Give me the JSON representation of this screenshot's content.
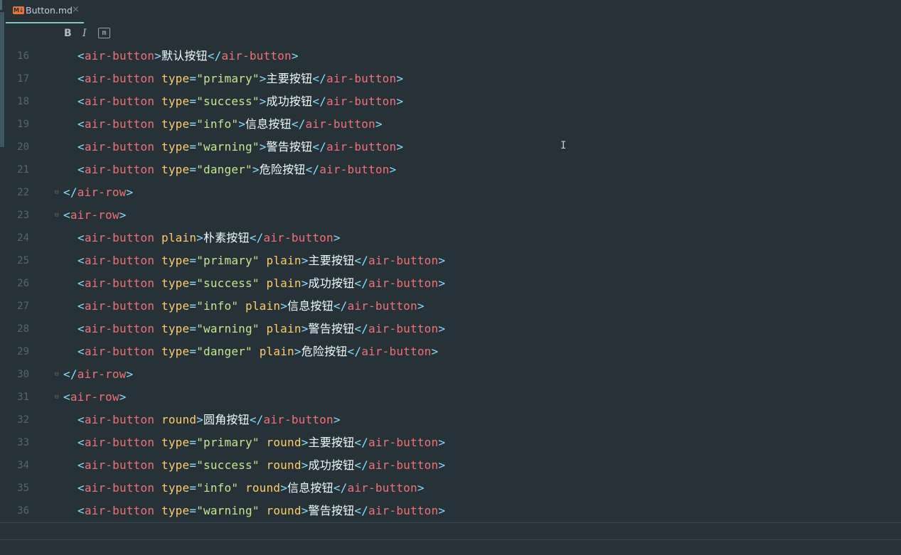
{
  "tab": {
    "icon": "markdown-icon",
    "icon_text": "M↓",
    "label": "Button.md",
    "close": "×"
  },
  "toolbar": {
    "bold": "B",
    "italic": "I",
    "mono": "m"
  },
  "colors": {
    "bg": "#263238",
    "punct": "#89ddff",
    "tag": "#f07178",
    "attr": "#ffcb6b",
    "string": "#c3e88d",
    "text": "#eeffff"
  },
  "lines": [
    {
      "num": "16",
      "indent": true,
      "fold": false,
      "tokens": [
        [
          "p",
          "<"
        ],
        [
          "t",
          "air-button"
        ],
        [
          "p",
          ">"
        ],
        [
          "x",
          "默认按钮"
        ],
        [
          "p",
          "</"
        ],
        [
          "t",
          "air-button"
        ],
        [
          "p",
          ">"
        ]
      ]
    },
    {
      "num": "17",
      "indent": true,
      "fold": false,
      "tokens": [
        [
          "p",
          "<"
        ],
        [
          "t",
          "air-button"
        ],
        [
          "a",
          " type"
        ],
        [
          "p",
          "="
        ],
        [
          "s",
          "\"primary\""
        ],
        [
          "p",
          ">"
        ],
        [
          "x",
          "主要按钮"
        ],
        [
          "p",
          "</"
        ],
        [
          "t",
          "air-button"
        ],
        [
          "p",
          ">"
        ]
      ]
    },
    {
      "num": "18",
      "indent": true,
      "fold": false,
      "tokens": [
        [
          "p",
          "<"
        ],
        [
          "t",
          "air-button"
        ],
        [
          "a",
          " type"
        ],
        [
          "p",
          "="
        ],
        [
          "s",
          "\"success\""
        ],
        [
          "p",
          ">"
        ],
        [
          "x",
          "成功按钮"
        ],
        [
          "p",
          "</"
        ],
        [
          "t",
          "air-button"
        ],
        [
          "p",
          ">"
        ]
      ]
    },
    {
      "num": "19",
      "indent": true,
      "fold": false,
      "tokens": [
        [
          "p",
          "<"
        ],
        [
          "t",
          "air-button"
        ],
        [
          "a",
          " type"
        ],
        [
          "p",
          "="
        ],
        [
          "s",
          "\"info\""
        ],
        [
          "p",
          ">"
        ],
        [
          "x",
          "信息按钮"
        ],
        [
          "p",
          "</"
        ],
        [
          "t",
          "air-button"
        ],
        [
          "p",
          ">"
        ]
      ]
    },
    {
      "num": "20",
      "indent": true,
      "fold": false,
      "tokens": [
        [
          "p",
          "<"
        ],
        [
          "t",
          "air-button"
        ],
        [
          "a",
          " type"
        ],
        [
          "p",
          "="
        ],
        [
          "s",
          "\"warning\""
        ],
        [
          "p",
          ">"
        ],
        [
          "x",
          "警告按钮"
        ],
        [
          "p",
          "</"
        ],
        [
          "t",
          "air-button"
        ],
        [
          "p",
          ">"
        ]
      ]
    },
    {
      "num": "21",
      "indent": true,
      "fold": false,
      "tokens": [
        [
          "p",
          "<"
        ],
        [
          "t",
          "air-button"
        ],
        [
          "a",
          " type"
        ],
        [
          "p",
          "="
        ],
        [
          "s",
          "\"danger\""
        ],
        [
          "p",
          ">"
        ],
        [
          "x",
          "危险按钮"
        ],
        [
          "p",
          "</"
        ],
        [
          "t",
          "air-button"
        ],
        [
          "p",
          ">"
        ]
      ]
    },
    {
      "num": "22",
      "indent": false,
      "fold": true,
      "tokens": [
        [
          "p",
          "</"
        ],
        [
          "t",
          "air-row"
        ],
        [
          "p",
          ">"
        ]
      ]
    },
    {
      "num": "23",
      "indent": false,
      "fold": true,
      "tokens": [
        [
          "p",
          "<"
        ],
        [
          "t",
          "air-row"
        ],
        [
          "p",
          ">"
        ]
      ]
    },
    {
      "num": "24",
      "indent": true,
      "fold": false,
      "tokens": [
        [
          "p",
          "<"
        ],
        [
          "t",
          "air-button"
        ],
        [
          "a",
          " plain"
        ],
        [
          "p",
          ">"
        ],
        [
          "x",
          "朴素按钮"
        ],
        [
          "p",
          "</"
        ],
        [
          "t",
          "air-button"
        ],
        [
          "p",
          ">"
        ]
      ]
    },
    {
      "num": "25",
      "indent": true,
      "fold": false,
      "tokens": [
        [
          "p",
          "<"
        ],
        [
          "t",
          "air-button"
        ],
        [
          "a",
          " type"
        ],
        [
          "p",
          "="
        ],
        [
          "s",
          "\"primary\""
        ],
        [
          "a",
          " plain"
        ],
        [
          "p",
          ">"
        ],
        [
          "x",
          "主要按钮"
        ],
        [
          "p",
          "</"
        ],
        [
          "t",
          "air-button"
        ],
        [
          "p",
          ">"
        ]
      ]
    },
    {
      "num": "26",
      "indent": true,
      "fold": false,
      "tokens": [
        [
          "p",
          "<"
        ],
        [
          "t",
          "air-button"
        ],
        [
          "a",
          " type"
        ],
        [
          "p",
          "="
        ],
        [
          "s",
          "\"success\""
        ],
        [
          "a",
          " plain"
        ],
        [
          "p",
          ">"
        ],
        [
          "x",
          "成功按钮"
        ],
        [
          "p",
          "</"
        ],
        [
          "t",
          "air-button"
        ],
        [
          "p",
          ">"
        ]
      ]
    },
    {
      "num": "27",
      "indent": true,
      "fold": false,
      "tokens": [
        [
          "p",
          "<"
        ],
        [
          "t",
          "air-button"
        ],
        [
          "a",
          " type"
        ],
        [
          "p",
          "="
        ],
        [
          "s",
          "\"info\""
        ],
        [
          "a",
          " plain"
        ],
        [
          "p",
          ">"
        ],
        [
          "x",
          "信息按钮"
        ],
        [
          "p",
          "</"
        ],
        [
          "t",
          "air-button"
        ],
        [
          "p",
          ">"
        ]
      ]
    },
    {
      "num": "28",
      "indent": true,
      "fold": false,
      "tokens": [
        [
          "p",
          "<"
        ],
        [
          "t",
          "air-button"
        ],
        [
          "a",
          " type"
        ],
        [
          "p",
          "="
        ],
        [
          "s",
          "\"warning\""
        ],
        [
          "a",
          " plain"
        ],
        [
          "p",
          ">"
        ],
        [
          "x",
          "警告按钮"
        ],
        [
          "p",
          "</"
        ],
        [
          "t",
          "air-button"
        ],
        [
          "p",
          ">"
        ]
      ]
    },
    {
      "num": "29",
      "indent": true,
      "fold": false,
      "tokens": [
        [
          "p",
          "<"
        ],
        [
          "t",
          "air-button"
        ],
        [
          "a",
          " type"
        ],
        [
          "p",
          "="
        ],
        [
          "s",
          "\"danger\""
        ],
        [
          "a",
          " plain"
        ],
        [
          "p",
          ">"
        ],
        [
          "x",
          "危险按钮"
        ],
        [
          "p",
          "</"
        ],
        [
          "t",
          "air-button"
        ],
        [
          "p",
          ">"
        ]
      ]
    },
    {
      "num": "30",
      "indent": false,
      "fold": true,
      "tokens": [
        [
          "p",
          "</"
        ],
        [
          "t",
          "air-row"
        ],
        [
          "p",
          ">"
        ]
      ]
    },
    {
      "num": "31",
      "indent": false,
      "fold": true,
      "tokens": [
        [
          "p",
          "<"
        ],
        [
          "t",
          "air-row"
        ],
        [
          "p",
          ">"
        ]
      ]
    },
    {
      "num": "32",
      "indent": true,
      "fold": false,
      "tokens": [
        [
          "p",
          "<"
        ],
        [
          "t",
          "air-button"
        ],
        [
          "a",
          " round"
        ],
        [
          "p",
          ">"
        ],
        [
          "x",
          "圆角按钮"
        ],
        [
          "p",
          "</"
        ],
        [
          "t",
          "air-button"
        ],
        [
          "p",
          ">"
        ]
      ]
    },
    {
      "num": "33",
      "indent": true,
      "fold": false,
      "tokens": [
        [
          "p",
          "<"
        ],
        [
          "t",
          "air-button"
        ],
        [
          "a",
          " type"
        ],
        [
          "p",
          "="
        ],
        [
          "s",
          "\"primary\""
        ],
        [
          "a",
          " round"
        ],
        [
          "p",
          ">"
        ],
        [
          "x",
          "主要按钮"
        ],
        [
          "p",
          "</"
        ],
        [
          "t",
          "air-button"
        ],
        [
          "p",
          ">"
        ]
      ]
    },
    {
      "num": "34",
      "indent": true,
      "fold": false,
      "tokens": [
        [
          "p",
          "<"
        ],
        [
          "t",
          "air-button"
        ],
        [
          "a",
          " type"
        ],
        [
          "p",
          "="
        ],
        [
          "s",
          "\"success\""
        ],
        [
          "a",
          " round"
        ],
        [
          "p",
          ">"
        ],
        [
          "x",
          "成功按钮"
        ],
        [
          "p",
          "</"
        ],
        [
          "t",
          "air-button"
        ],
        [
          "p",
          ">"
        ]
      ]
    },
    {
      "num": "35",
      "indent": true,
      "fold": false,
      "tokens": [
        [
          "p",
          "<"
        ],
        [
          "t",
          "air-button"
        ],
        [
          "a",
          " type"
        ],
        [
          "p",
          "="
        ],
        [
          "s",
          "\"info\""
        ],
        [
          "a",
          " round"
        ],
        [
          "p",
          ">"
        ],
        [
          "x",
          "信息按钮"
        ],
        [
          "p",
          "</"
        ],
        [
          "t",
          "air-button"
        ],
        [
          "p",
          ">"
        ]
      ]
    },
    {
      "num": "36",
      "indent": true,
      "fold": false,
      "tokens": [
        [
          "p",
          "<"
        ],
        [
          "t",
          "air-button"
        ],
        [
          "a",
          " type"
        ],
        [
          "p",
          "="
        ],
        [
          "s",
          "\"warning\""
        ],
        [
          "a",
          " round"
        ],
        [
          "p",
          ">"
        ],
        [
          "x",
          "警告按钮"
        ],
        [
          "p",
          "</"
        ],
        [
          "t",
          "air-button"
        ],
        [
          "p",
          ">"
        ]
      ]
    }
  ]
}
